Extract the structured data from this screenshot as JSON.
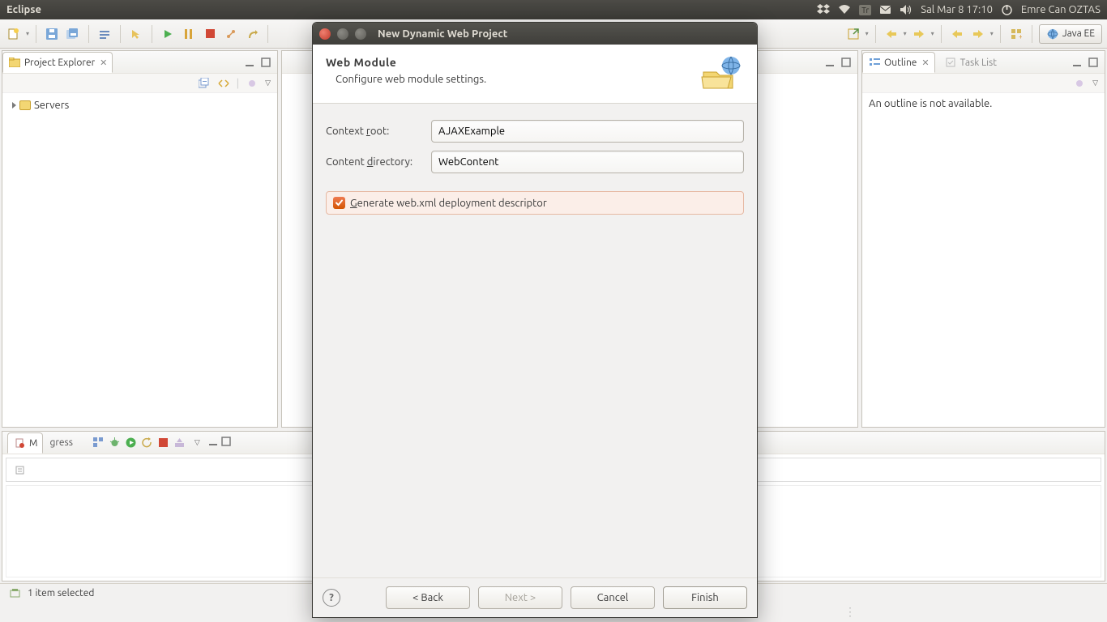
{
  "system": {
    "app_title": "Eclipse",
    "clock": "Sal Mar  8 17:10",
    "user": "Emre Can OZTAS",
    "keyboard_indicator": "Tr"
  },
  "toolbar": {
    "perspective_label": "Java EE"
  },
  "project_explorer": {
    "title": "Project Explorer",
    "items": [
      "Servers"
    ]
  },
  "outline": {
    "title": "Outline",
    "tasklist_title": "Task List",
    "empty_text": "An outline is not available."
  },
  "bottom_panel": {
    "tab_markers_initial": "M",
    "tab_progress_suffix": "gress"
  },
  "statusbar": {
    "text": "1 item selected"
  },
  "dialog": {
    "window_title": "New Dynamic Web Project",
    "heading": "Web Module",
    "subheading": "Configure web module settings.",
    "context_root_label_pre": "Context ",
    "context_root_underline": "r",
    "context_root_label_post": "oot:",
    "context_root_value": "AJAXExample",
    "content_dir_label_pre": "Content ",
    "content_dir_underline": "d",
    "content_dir_label_post": "irectory:",
    "content_dir_value": "WebContent",
    "generate_webxml_underline": "G",
    "generate_webxml_label_post": "enerate web.xml deployment descriptor",
    "generate_webxml_checked": true,
    "buttons": {
      "back": "< Back",
      "next": "Next >",
      "cancel": "Cancel",
      "finish": "Finish"
    }
  }
}
